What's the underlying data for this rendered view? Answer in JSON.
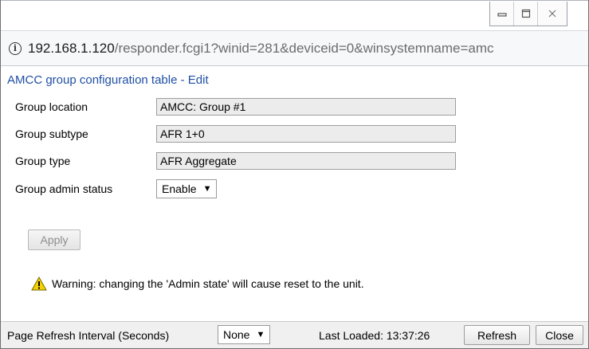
{
  "window": {
    "controls": {
      "minimize_icon": "minimize-icon",
      "maximize_icon": "maximize-icon",
      "close_icon": "close-icon"
    }
  },
  "addressbar": {
    "host": "192.168.1.120",
    "path": "/responder.fcgi1?winid=281&deviceid=0&winsystemname=amc"
  },
  "page": {
    "title": "AMCC group configuration table - Edit",
    "fields": [
      {
        "label": "Group location",
        "value": "AMCC: Group #1"
      },
      {
        "label": "Group subtype",
        "value": "AFR 1+0"
      },
      {
        "label": "Group type",
        "value": "AFR Aggregate"
      }
    ],
    "admin_status": {
      "label": "Group admin status",
      "value": "Enable"
    },
    "apply_label": "Apply",
    "warning": "Warning: changing the 'Admin state' will cause reset to the unit."
  },
  "footer": {
    "refresh_interval_label": "Page Refresh Interval (Seconds)",
    "refresh_interval_value": "None",
    "last_loaded": "Last Loaded: 13:37:26",
    "refresh_label": "Refresh",
    "close_label": "Close"
  },
  "colors": {
    "title": "#1f4fa3",
    "field_bg": "#ececec",
    "warning_icon": "#f2d200"
  }
}
